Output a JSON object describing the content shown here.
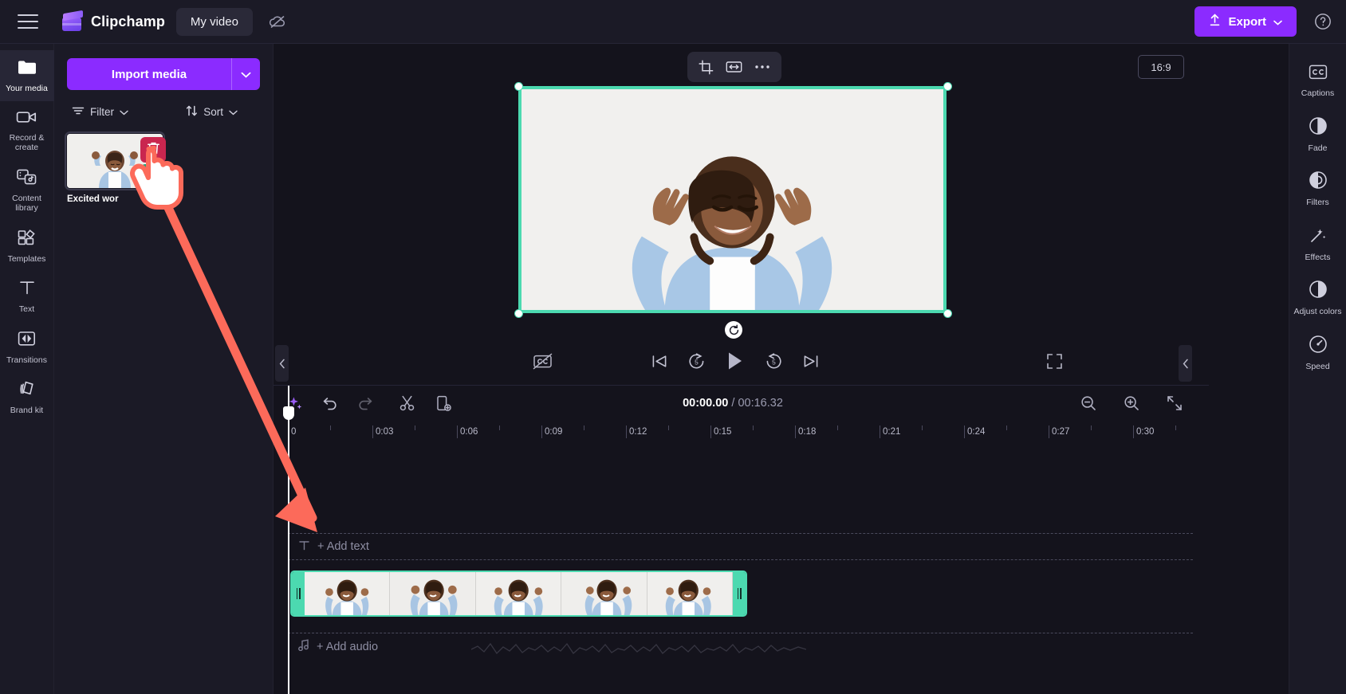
{
  "app": {
    "brand": "Clipchamp",
    "project_name": "My video",
    "menu_icon": "hamburger-icon",
    "logo_icon": "clipchamp-logo-icon",
    "cloud_icon": "cloud-off-icon",
    "export_label": "Export",
    "export_icon": "upload-icon",
    "export_caret_icon": "chevron-down-icon",
    "help_icon": "help-circle-icon",
    "accent_color": "#8b2bff",
    "selection_color": "#4cd9b0",
    "danger_color": "#c9264f",
    "success_color": "#2aa179"
  },
  "left_rail": {
    "items": [
      {
        "label": "Your media",
        "icon": "folder-icon",
        "active": true
      },
      {
        "label": "Record & create",
        "icon": "video-camera-icon",
        "active": false
      },
      {
        "label": "Content library",
        "icon": "content-library-icon",
        "active": false
      },
      {
        "label": "Templates",
        "icon": "templates-grid-icon",
        "active": false
      },
      {
        "label": "Text",
        "icon": "text-t-icon",
        "active": false
      },
      {
        "label": "Transitions",
        "icon": "transitions-icon",
        "active": false
      },
      {
        "label": "Brand kit",
        "icon": "brand-kit-icon",
        "active": false
      }
    ]
  },
  "media_panel": {
    "import_label": "Import media",
    "import_caret_icon": "chevron-down-icon",
    "filter_label": "Filter",
    "filter_icon": "filter-lines-icon",
    "sort_label": "Sort",
    "sort_icon": "sort-arrows-icon",
    "caret_icon": "chevron-down-icon",
    "media_items": [
      {
        "label": "Excited wor",
        "delete_icon": "trash-icon",
        "add_icon": "add-to-timeline-icon"
      }
    ]
  },
  "preview": {
    "float_toolbar": [
      {
        "icon": "crop-icon",
        "name": "crop-button"
      },
      {
        "icon": "fit-width-icon",
        "name": "fit-button"
      },
      {
        "icon": "more-dots-icon",
        "name": "more-options-button"
      }
    ],
    "aspect_ratio": "16:9",
    "rotate_icon": "rotate-icon",
    "controls": {
      "captions_icon": "closed-captions-off-icon",
      "skip_start_icon": "skip-to-start-icon",
      "back5_icon": "rewind-5-icon",
      "play_icon": "play-icon",
      "forward5_icon": "forward-5-icon",
      "skip_end_icon": "skip-to-end-icon",
      "fullscreen_icon": "fullscreen-icon"
    },
    "collapse_left_icon": "chevron-left-icon",
    "collapse_right_icon": "chevron-left-icon"
  },
  "right_rail": {
    "items": [
      {
        "label": "Captions",
        "icon": "cc-icon"
      },
      {
        "label": "Fade",
        "icon": "fade-icon"
      },
      {
        "label": "Filters",
        "icon": "filters-icon"
      },
      {
        "label": "Effects",
        "icon": "effects-wand-icon"
      },
      {
        "label": "Adjust colors",
        "icon": "adjust-colors-icon"
      },
      {
        "label": "Speed",
        "icon": "speed-gauge-icon"
      }
    ]
  },
  "timeline": {
    "toolbar": [
      {
        "icon": "ai-sparkle-icon",
        "name": "ai-tools-button",
        "state": "accent"
      },
      {
        "icon": "undo-icon",
        "name": "undo-button",
        "state": "enabled"
      },
      {
        "icon": "redo-icon",
        "name": "redo-button",
        "state": "disabled"
      },
      {
        "icon": "scissors-icon",
        "name": "split-button",
        "state": "enabled"
      },
      {
        "icon": "duplicate-icon",
        "name": "duplicate-button",
        "state": "enabled"
      }
    ],
    "current_time": "00:00.00",
    "separator": "/",
    "total_time": "00:16.32",
    "zoom_out_icon": "zoom-out-icon",
    "zoom_in_icon": "zoom-in-icon",
    "fit_icon": "fit-timeline-icon",
    "ruler_labels": [
      "0",
      "0:03",
      "0:06",
      "0:09",
      "0:12",
      "0:15",
      "0:18",
      "0:21",
      "0:24",
      "0:27",
      "0:30"
    ],
    "tracks": [
      {
        "label": "+ Add text",
        "icon": "text-t-icon",
        "name": "add-text-track"
      },
      {
        "label": "+ Add audio",
        "icon": "music-note-icon",
        "name": "add-audio-track"
      }
    ],
    "clip": {
      "name": "video-clip",
      "frames": 5,
      "trim_icon": "trim-handle-icon"
    }
  },
  "annotation": {
    "cursor_icon": "pointing-hand-cursor",
    "arrow_icon": "drag-arrow",
    "arrow_color": "#fc6a5a"
  }
}
